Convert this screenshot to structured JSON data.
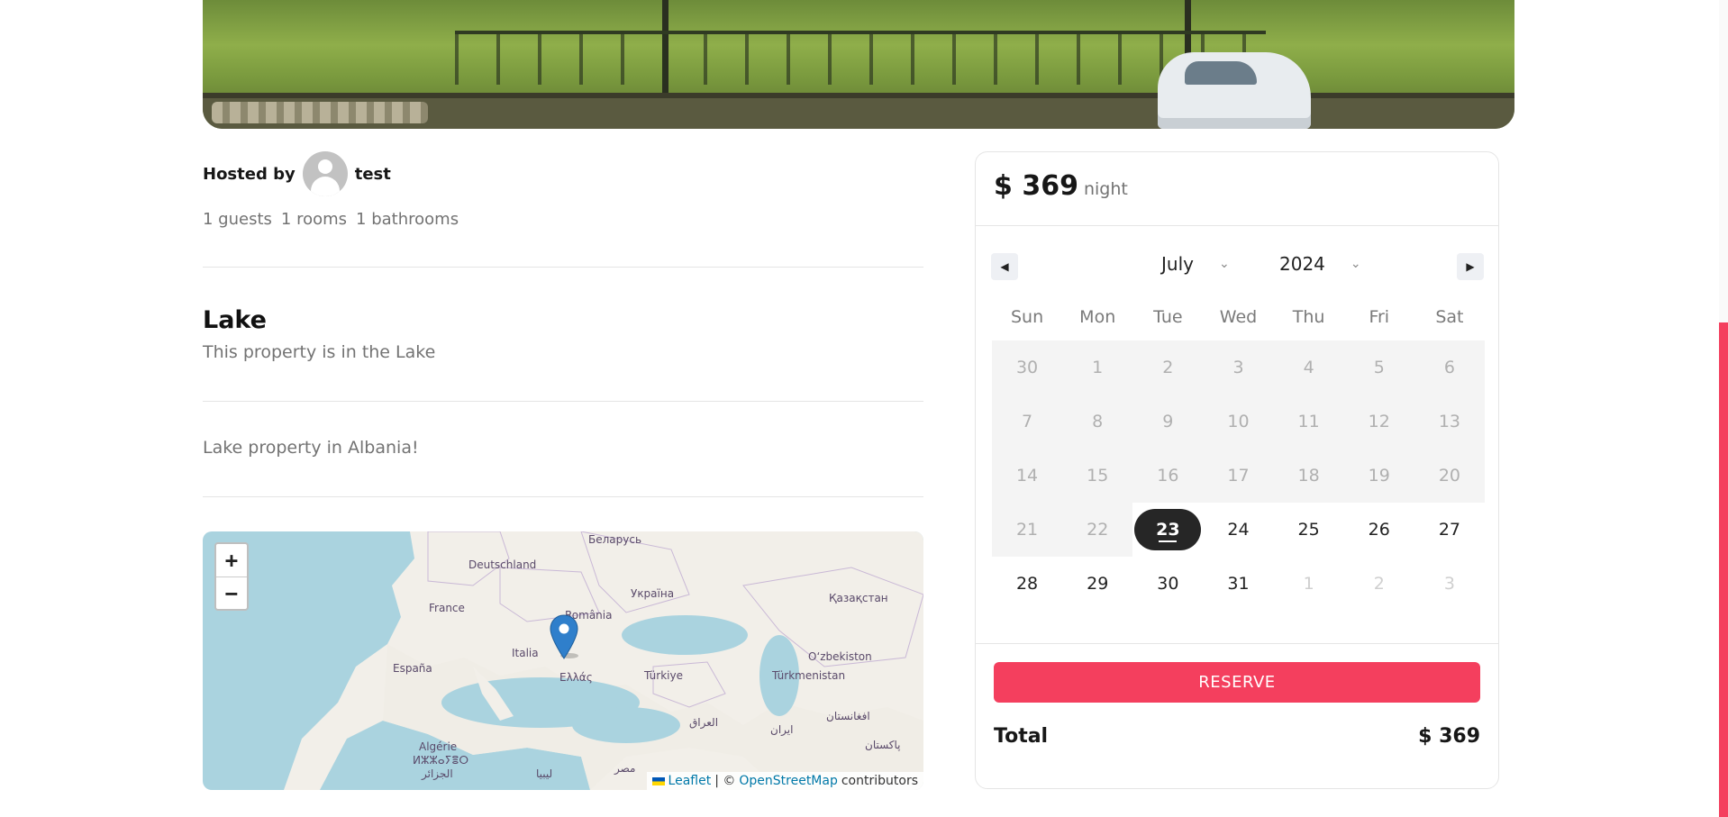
{
  "host": {
    "label": "Hosted by",
    "name": "test"
  },
  "stats": {
    "guests": "1 guests",
    "rooms": "1 rooms",
    "bathrooms": "1 bathrooms"
  },
  "category": {
    "title": "Lake",
    "description": "This property is in the Lake"
  },
  "description": "Lake property in Albania!",
  "map": {
    "zoom_in": "+",
    "zoom_out": "−",
    "labels": [
      "Беларусь",
      "Deutschland",
      "Україна",
      "France",
      "România",
      "Қазақстан",
      "Italia",
      "España",
      "Türkiye",
      "Oʻzbekiston",
      "Türkmenistan",
      "Ελλάς",
      "العراق",
      "ایران",
      "افغانستان",
      "Algérie",
      "ⵍⵣⵣⴰⵢⴻⵔ",
      "الجزائر",
      "ليبيا",
      "مصر",
      "پاکستان"
    ],
    "attribution": {
      "leaflet": "Leaflet",
      "separator": "| ©",
      "osm": "OpenStreetMap",
      "suffix": "contributors"
    }
  },
  "booking": {
    "price": "$ 369",
    "per": "night",
    "prev_icon": "◀",
    "next_icon": "▶",
    "month": "July",
    "year": "2024",
    "weekdays": [
      "Sun",
      "Mon",
      "Tue",
      "Wed",
      "Thu",
      "Fri",
      "Sat"
    ],
    "days": [
      {
        "d": "30",
        "s": "disabled"
      },
      {
        "d": "1",
        "s": "disabled"
      },
      {
        "d": "2",
        "s": "disabled"
      },
      {
        "d": "3",
        "s": "disabled"
      },
      {
        "d": "4",
        "s": "disabled"
      },
      {
        "d": "5",
        "s": "disabled"
      },
      {
        "d": "6",
        "s": "disabled"
      },
      {
        "d": "7",
        "s": "disabled"
      },
      {
        "d": "8",
        "s": "disabled"
      },
      {
        "d": "9",
        "s": "disabled"
      },
      {
        "d": "10",
        "s": "disabled"
      },
      {
        "d": "11",
        "s": "disabled"
      },
      {
        "d": "12",
        "s": "disabled"
      },
      {
        "d": "13",
        "s": "disabled"
      },
      {
        "d": "14",
        "s": "disabled"
      },
      {
        "d": "15",
        "s": "disabled"
      },
      {
        "d": "16",
        "s": "disabled"
      },
      {
        "d": "17",
        "s": "disabled"
      },
      {
        "d": "18",
        "s": "disabled"
      },
      {
        "d": "19",
        "s": "disabled"
      },
      {
        "d": "20",
        "s": "disabled"
      },
      {
        "d": "21",
        "s": "disabled"
      },
      {
        "d": "22",
        "s": "disabled"
      },
      {
        "d": "23",
        "s": "selected"
      },
      {
        "d": "24",
        "s": "normal"
      },
      {
        "d": "25",
        "s": "normal"
      },
      {
        "d": "26",
        "s": "normal"
      },
      {
        "d": "27",
        "s": "normal"
      },
      {
        "d": "28",
        "s": "normal"
      },
      {
        "d": "29",
        "s": "normal"
      },
      {
        "d": "30",
        "s": "normal"
      },
      {
        "d": "31",
        "s": "normal"
      },
      {
        "d": "1",
        "s": "outside"
      },
      {
        "d": "2",
        "s": "outside"
      },
      {
        "d": "3",
        "s": "outside"
      }
    ],
    "reserve_label": "RESERVE",
    "total_label": "Total",
    "total_value": "$ 369"
  },
  "colors": {
    "accent": "#f43f5e",
    "selected": "#262626",
    "muted": "#737373"
  }
}
